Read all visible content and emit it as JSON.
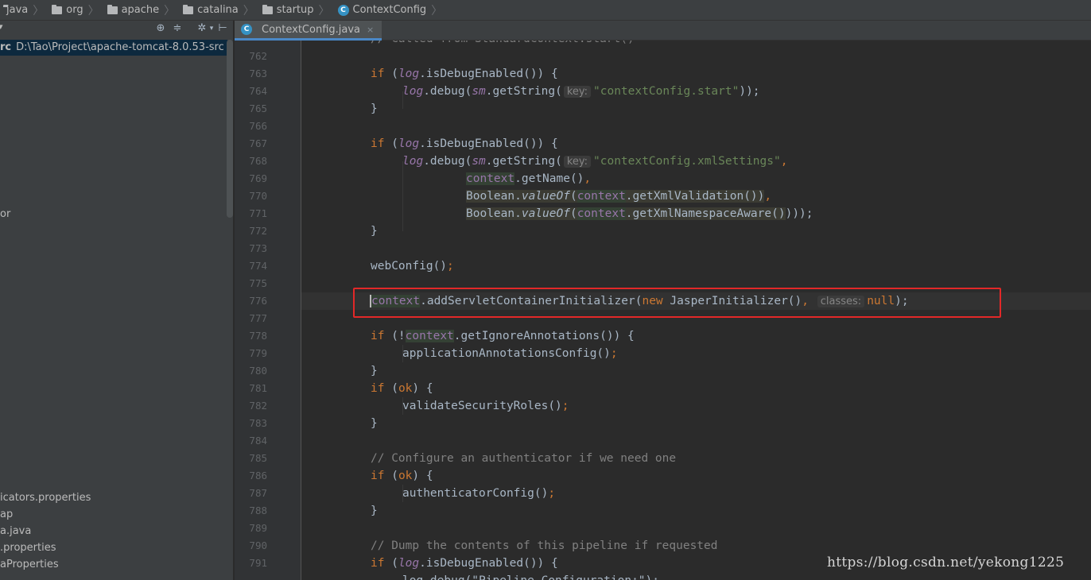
{
  "breadcrumb": [
    {
      "label": "java",
      "icon": "folder-icon"
    },
    {
      "label": "org",
      "icon": "folder-icon"
    },
    {
      "label": "apache",
      "icon": "folder-icon"
    },
    {
      "label": "catalina",
      "icon": "folder-icon"
    },
    {
      "label": "startup",
      "icon": "folder-icon"
    },
    {
      "label": "ContextConfig",
      "icon": "class-icon"
    }
  ],
  "class_icon_letter": "C",
  "project_panel": {
    "root": {
      "name": "rc",
      "path": "D:\\Tao\\Project\\apache-tomcat-8.0.53-src"
    },
    "items": [
      "or",
      "icators.properties",
      "ap",
      "a.java",
      ".properties",
      "aProperties"
    ]
  },
  "tab": {
    "label": "ContextConfig.java",
    "close": "×"
  },
  "editor": {
    "line_numbers": [
      "762",
      "763",
      "764",
      "765",
      "766",
      "767",
      "768",
      "769",
      "770",
      "771",
      "772",
      "773",
      "774",
      "775",
      "776",
      "777",
      "778",
      "779",
      "780",
      "781",
      "782",
      "783",
      "784",
      "785",
      "786",
      "787",
      "788",
      "789",
      "790",
      "791"
    ],
    "partial_top_line": "// Called from StandardContext.start()",
    "partial_bottom_line": "log.debug(\"Pipeline Configuration:\");",
    "hints": {
      "key": "key:",
      "classes": "classes:"
    },
    "code": {
      "if": "if",
      "new": "new",
      "null": "null",
      "log": "log",
      "sm": "sm",
      "context": "context",
      "ok": "ok",
      "s_is_debug": ".isDebugEnabled()) {",
      "s_debug_open": ".debug(",
      "s_get_string": ".getString(",
      "str_start": "\"contextConfig.start\"",
      "s_close_semi": "));",
      "brace_close": "}",
      "str_xml": "\"contextConfig.xmlSettings\"",
      "comma": ",",
      "s_getname": ".getName()",
      "boolean": "Boolean.",
      "value_of": "valueOf",
      "paren_open": "(",
      "s_get_xml_val": ".getXmlValidation()",
      "paren_close": ")",
      "s_get_xml_ns": ".getXmlNamespaceAware()",
      "s_close_close_semi": ")));",
      "web_config": "webConfig()",
      "semi": ";",
      "s_add_init": ".addServletContainerInitializer(",
      "jasper": " JasperInitializer()",
      "close_semi": ");",
      "paren_not": "(!",
      "s_ignore_ann": ".getIgnoreAnnotations()) {",
      "app_ann": "applicationAnnotationsConfig()",
      "paren_ok_open": "(",
      "s_brace_open": ") {",
      "validate": "validateSecurityRoles()",
      "cmt_auth": "// Configure an authenticator if we need one",
      "auth_config": "authenticatorConfig()",
      "cmt_dump": "// Dump the contents of this pipeline if requested"
    }
  },
  "watermark": "https://blog.csdn.net/yekong1225",
  "colors": {
    "keyword": "#cc7832",
    "string": "#6a8759",
    "field": "#9876aa",
    "highlight_box": "#e22828"
  }
}
